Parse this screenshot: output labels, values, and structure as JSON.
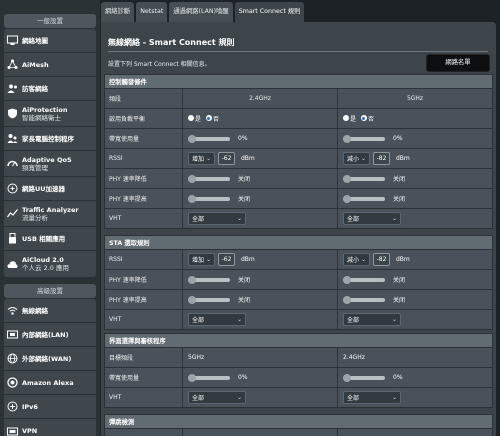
{
  "sidebar": {
    "general_header": "一般設置",
    "general": [
      {
        "label": "網絡地圖",
        "icon": "network-map-icon"
      },
      {
        "label": "AiMesh",
        "icon": "aimesh-icon"
      },
      {
        "label": "訪客網絡",
        "icon": "guest-network-icon"
      },
      {
        "label": "AiProtection",
        "sub": "智能網絡衛士",
        "icon": "shield-icon"
      },
      {
        "label": "家長電腦控制程序",
        "icon": "parental-control-icon"
      },
      {
        "label": "Adaptive QoS",
        "sub": "頻寬管理",
        "icon": "qos-icon"
      },
      {
        "label": "網路UU加速器",
        "icon": "game-accelerator-icon"
      },
      {
        "label": "Traffic Analyzer",
        "sub": "流量分析",
        "icon": "traffic-analyzer-icon"
      },
      {
        "label": "USB 相關應用",
        "icon": "usb-icon"
      },
      {
        "label": "AiCloud 2.0",
        "sub": "个人云 2.0 應用",
        "icon": "cloud-icon"
      }
    ],
    "advanced_header": "高級設置",
    "advanced": [
      {
        "label": "無線網絡",
        "icon": "wifi-icon"
      },
      {
        "label": "內部網絡(LAN)",
        "icon": "lan-icon"
      },
      {
        "label": "外部網絡(WAN)",
        "icon": "globe-icon"
      },
      {
        "label": "Amazon Alexa",
        "icon": "alexa-icon"
      },
      {
        "label": "IPv6",
        "icon": "ipv6-icon"
      },
      {
        "label": "VPN",
        "icon": "vpn-icon"
      }
    ]
  },
  "tabs": [
    "網絡診斷",
    "Netstat",
    "通過網路(LAN)喚醒",
    "Smart Connect 規則"
  ],
  "active_tab": 3,
  "page": {
    "title": "無線網絡 - Smart Connect 規則",
    "description": "設置下列 Smart Connect 相關信息。",
    "steering_button": "網路名單"
  },
  "trigger": {
    "header": "控制觸發條件",
    "band_label": "頻段",
    "band_24": "2.4GHz",
    "band_5": "5GHz",
    "load_balance_label": "啟用負載平衡",
    "radio_yes": "是",
    "radio_no": "否",
    "bandwidth_label": "帶寬使用量",
    "bw_24": "0%",
    "bw_5": "0%",
    "rssi_label": "RSSI",
    "rssi_24_op": "增加",
    "rssi_24_val": "-62",
    "rssi_5_op": "減小",
    "rssi_5_val": "-82",
    "dbm": "dBm",
    "phy_low_label": "PHY 速率降低",
    "phy_high_label": "PHY 速率提高",
    "off": "关闭",
    "vht_label": "VHT",
    "all": "全部"
  },
  "sta": {
    "header": "STA 選取規則",
    "rssi_label": "RSSI",
    "rssi_24_op": "增加",
    "rssi_24_val": "-62",
    "rssi_5_op": "減小",
    "rssi_5_val": "-82",
    "dbm": "dBm",
    "phy_low_label": "PHY 速率降低",
    "phy_high_label": "PHY 速率提高",
    "off": "关闭",
    "vht_label": "VHT",
    "all": "全部"
  },
  "iface": {
    "header": "界面選擇與審核程序",
    "target_label": "目標頻段",
    "target_24": "5GHz",
    "target_5": "2.4GHz",
    "bandwidth_label": "帶寬使用量",
    "bw_24": "0%",
    "bw_5": "0%",
    "vht_label": "VHT",
    "all": "全部"
  },
  "bounce": {
    "header": "彈跳檢測"
  },
  "colors": {
    "background": "#1d2226",
    "panel": "#3d454a",
    "section_header": "#616b72",
    "radio_selected": "#2f6fbf"
  }
}
